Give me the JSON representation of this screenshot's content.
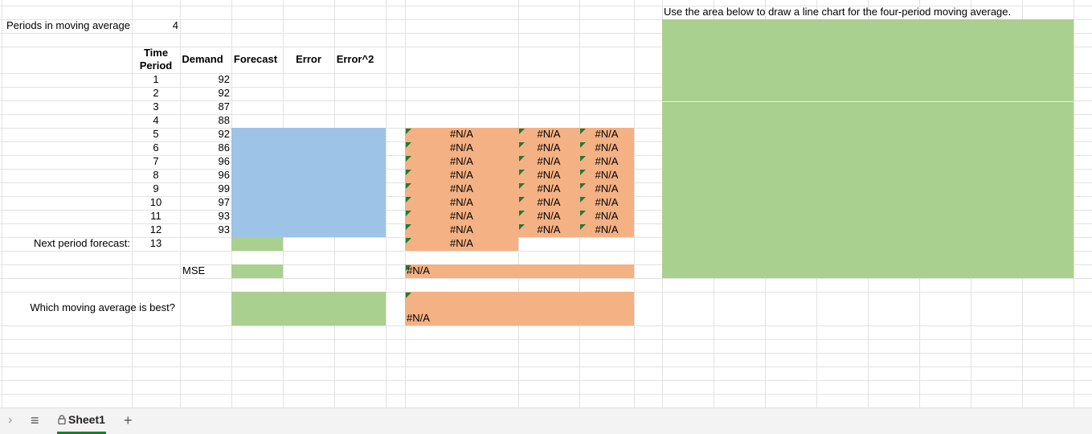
{
  "header": {
    "periods_label": "Periods in moving average",
    "periods_value": "4",
    "chart_instruction": "Use the area below to draw a line chart for the four-period moving average."
  },
  "table": {
    "columns": {
      "time_period_line1": "Time",
      "time_period_line2": "Period",
      "demand": "Demand",
      "forecast": "Forecast",
      "error": "Error",
      "error_sq": "Error^2"
    },
    "rows": [
      {
        "period": "1",
        "demand": "92"
      },
      {
        "period": "2",
        "demand": "92"
      },
      {
        "period": "3",
        "demand": "87"
      },
      {
        "period": "4",
        "demand": "88"
      },
      {
        "period": "5",
        "demand": "92"
      },
      {
        "period": "6",
        "demand": "86"
      },
      {
        "period": "7",
        "demand": "96"
      },
      {
        "period": "8",
        "demand": "96"
      },
      {
        "period": "9",
        "demand": "99"
      },
      {
        "period": "10",
        "demand": "97"
      },
      {
        "period": "11",
        "demand": "93"
      },
      {
        "period": "12",
        "demand": "93"
      }
    ],
    "next_forecast_label": "Next period forecast:",
    "next_forecast_period": "13",
    "mse_label": "MSE",
    "best_question": "Which moving average is best?"
  },
  "check_cells": {
    "na": "#N/A"
  },
  "sheet_tabs": {
    "active": "Sheet1",
    "add_symbol": "+",
    "menu_symbol": "≡",
    "nav_symbol": "›"
  },
  "colors": {
    "input_blue": "#9dc3e6",
    "answer_green": "#a9d08e",
    "check_orange": "#f4b183",
    "tab_accent": "#1e7b34"
  }
}
